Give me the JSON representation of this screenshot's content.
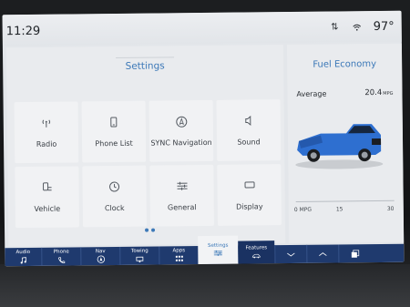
{
  "status": {
    "time": "11:29",
    "temperature": "97°"
  },
  "settings": {
    "title": "Settings",
    "tiles": [
      {
        "label": "Radio",
        "icon": "radio-antenna-icon"
      },
      {
        "label": "Phone List",
        "icon": "phone-list-icon"
      },
      {
        "label": "SYNC Navigation",
        "icon": "navigation-compass-icon"
      },
      {
        "label": "Sound",
        "icon": "speaker-icon"
      },
      {
        "label": "Vehicle",
        "icon": "vehicle-settings-icon"
      },
      {
        "label": "Clock",
        "icon": "clock-icon"
      },
      {
        "label": "General",
        "icon": "sliders-icon"
      },
      {
        "label": "Display",
        "icon": "display-icon"
      }
    ],
    "page_count": 2
  },
  "fuel": {
    "title": "Fuel Economy",
    "average_label": "Average",
    "average_value": "20.4",
    "average_unit": "MPG",
    "scale": [
      "0 MPG",
      "15",
      "30"
    ],
    "truck_color": "#2e6fd0"
  },
  "nav": {
    "items": [
      {
        "label": "Audio",
        "icon": "music-note-icon"
      },
      {
        "label": "Phone",
        "icon": "phone-icon"
      },
      {
        "label": "Nav",
        "icon": "navigation-icon"
      },
      {
        "label": "Towing",
        "icon": "trailer-icon"
      },
      {
        "label": "Apps",
        "icon": "apps-grid-icon"
      },
      {
        "label": "Settings",
        "icon": "settings-sliders-icon",
        "active": true
      },
      {
        "label": "Features",
        "icon": "car-features-icon"
      }
    ],
    "controls": [
      "chevron-down-icon",
      "chevron-up-icon",
      "copy-screens-icon"
    ]
  },
  "colors": {
    "accent": "#3d79b8",
    "nav_bar": "#1f3a6e",
    "screen_bg": "#e3e6ea"
  }
}
